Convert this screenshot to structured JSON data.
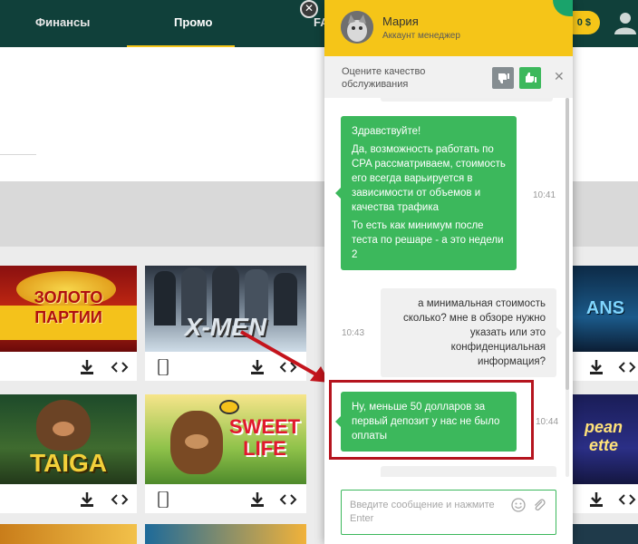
{
  "nav": {
    "items": [
      "Финансы",
      "Промо",
      "FA"
    ],
    "active": "Промо",
    "balance": "0 $",
    "accent": "#f5c518",
    "background": "#10403a"
  },
  "cards": [
    {
      "title": "ЗОЛОТО ПАРТИИ",
      "icons": [
        "download-icon",
        "embed-code-icon"
      ]
    },
    {
      "title": "X-MEN",
      "icons": [
        "mobile-icon",
        "download-icon",
        "embed-code-icon"
      ]
    },
    {
      "title": "TAIGA",
      "icons": [
        "download-icon",
        "embed-code-icon"
      ]
    },
    {
      "title": "SWEET LIFE",
      "icons": [
        "mobile-icon",
        "download-icon",
        "embed-code-icon"
      ]
    },
    {
      "title": "ANS",
      "icons": [
        "download-icon",
        "embed-code-icon"
      ]
    },
    {
      "title": "pean ette",
      "icons": [
        "download-icon",
        "embed-code-icon"
      ]
    }
  ],
  "chat": {
    "agent_name": "Мария",
    "agent_role": "Аккаунт менеджер",
    "rating_prompt": "Оцените качество обслуживания",
    "messages": [
      {
        "from": "agent",
        "time": "10:41",
        "paragraphs": [
          "Здравствуйте!",
          "Да, возможность работать по CPA рассматриваем, стоимость его всегда варьируется в зависимости от объемов и качества трафика",
          "То есть как минимум после теста по решаре - а это недели 2"
        ]
      },
      {
        "from": "user",
        "time": "10:43",
        "text": "а минимальная стоимость сколько? мне в обзоре нужно указать или это конфиденциальная информация?"
      },
      {
        "from": "agent",
        "time": "10:44",
        "text": "Ну, меньше 50 долларов за первый депозит у нас не было оплаты"
      }
    ],
    "input_placeholder": "Введите сообщение и нажмите Enter",
    "agent_bubble_color": "#3cb85c",
    "highlight_color": "#b5141e"
  }
}
